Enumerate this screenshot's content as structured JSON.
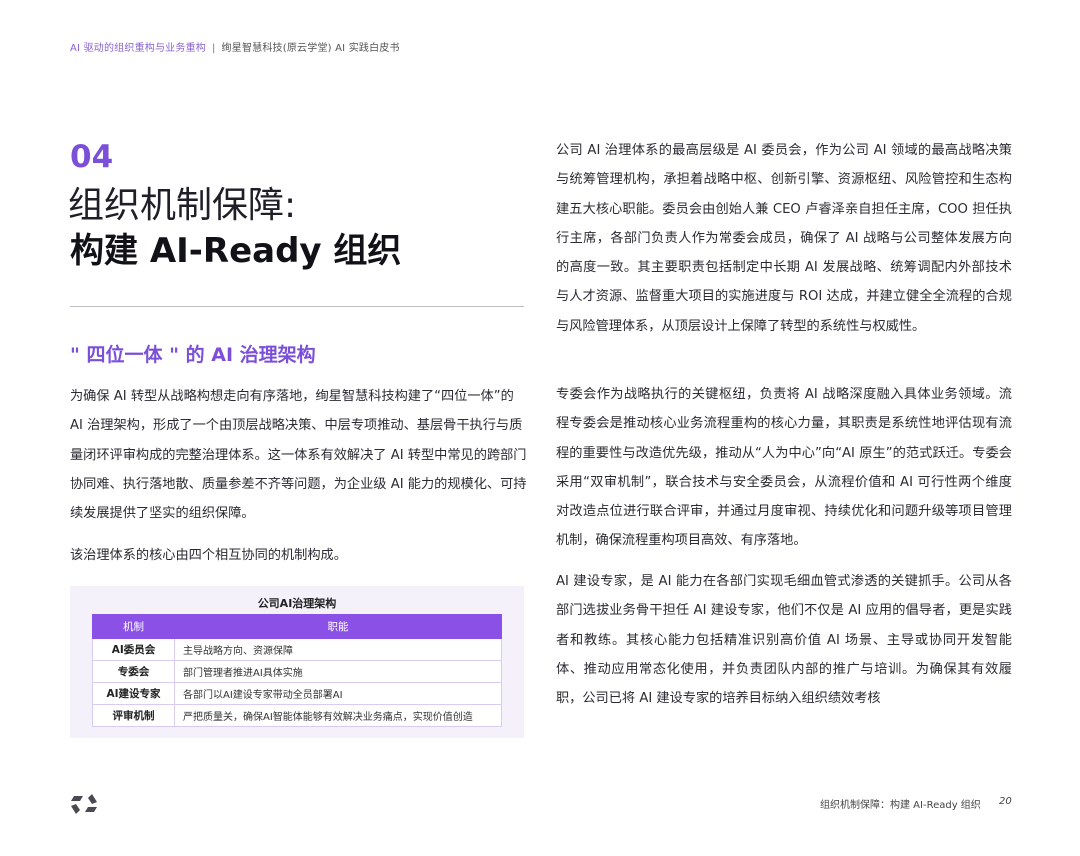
{
  "header": {
    "breadcrumb_primary": "AI 驱动的组织重构与业务重构",
    "separator": "|",
    "breadcrumb_secondary": "绚星智慧科技(原云学堂) AI 实践白皮书"
  },
  "chapter": {
    "number": "04",
    "title_line1": "组织机制保障:",
    "title_line2": "构建 AI-Ready 组织"
  },
  "section": {
    "heading": "\" 四位一体 \" 的 AI 治理架构"
  },
  "left_paragraphs": [
    "为确保 AI 转型从战略构想走向有序落地，绚星智慧科技构建了“四位一体”的 AI 治理架构，形成了一个由顶层战略决策、中层专项推动、基层骨干执行与质量闭环评审构成的完整治理体系。这一体系有效解决了 AI 转型中常见的跨部门协同难、执行落地散、质量参差不齐等问题，为企业级 AI 能力的规模化、可持续发展提供了坚实的组织保障。",
    "该治理体系的核心由四个相互协同的机制构成。"
  ],
  "governance_table": {
    "caption": "公司AI治理架构",
    "headers": [
      "机制",
      "职能"
    ],
    "rows": [
      {
        "mechanism": "AI委员会",
        "function": "主导战略方向、资源保障"
      },
      {
        "mechanism": "专委会",
        "function": "部门管理者推进AI具体实施"
      },
      {
        "mechanism": "AI建设专家",
        "function": "各部门以AI建设专家带动全员部署AI"
      },
      {
        "mechanism": "评审机制",
        "function": "严把质量关，确保AI智能体能够有效解决业务痛点，实现价值创造"
      }
    ]
  },
  "right_paragraphs": [
    "公司 AI 治理体系的最高层级是 AI 委员会，作为公司 AI 领域的最高战略决策与统筹管理机构，承担着战略中枢、创新引擎、资源枢纽、风险管控和生态构建五大核心职能。委员会由创始人兼 CEO 卢睿泽亲自担任主席，COO 担任执行主席，各部门负责人作为常委会成员，确保了 AI 战略与公司整体发展方向的高度一致。其主要职责包括制定中长期 AI 发展战略、统筹调配内外部技术与人才资源、监督重大项目的实施进度与 ROI 达成，并建立健全全流程的合规与风险管理体系，从顶层设计上保障了转型的系统性与权威性。",
    "专委会作为战略执行的关键枢纽，负责将 AI 战略深度融入具体业务领域。流程专委会是推动核心业务流程重构的核心力量，其职责是系统性地评估现有流程的重要性与改造优先级，推动从“人为中心”向“AI 原生”的范式跃迁。专委会采用“双审机制”，联合技术与安全委员会，从流程价值和 AI 可行性两个维度对改造点位进行联合评审，并通过月度审视、持续优化和问题升级等项目管理机制，确保流程重构项目高效、有序落地。",
    "AI 建设专家，是 AI 能力在各部门实现毛细血管式渗透的关键抓手。公司从各部门选拔业务骨干担任 AI 建设专家，他们不仅是 AI 应用的倡导者，更是实践者和教练。其核心能力包括精准识别高价值 AI 场景、主导或协同开发智能体、推动应用常态化使用，并负责团队内部的推广与培训。为确保其有效履职，公司已将 AI 建设专家的培养目标纳入组织绩效考核"
  ],
  "footer": {
    "text": "组织机制保障：构建 AI-Ready 组织",
    "page_number": "20"
  },
  "colors": {
    "accent_purple": "#7b4fd8",
    "table_header": "#8b50e6",
    "table_panel": "#f4f1fb"
  },
  "icons": {
    "logo": "brand-logo-icon"
  }
}
